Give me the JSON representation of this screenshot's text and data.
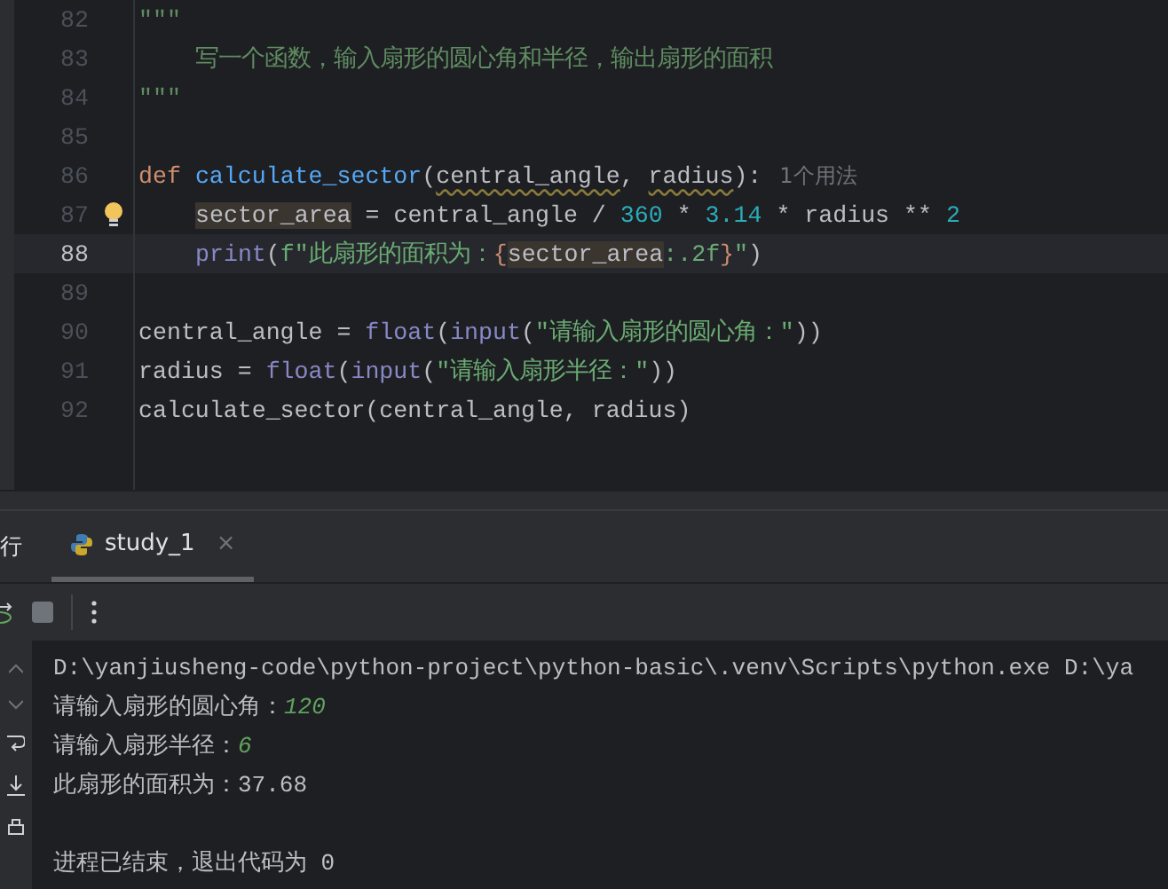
{
  "editor": {
    "lines": [
      {
        "number": "82",
        "current": false,
        "bulb": false,
        "indented": false,
        "tokens": [
          {
            "kind": "docstring",
            "text": "\"\"\""
          }
        ]
      },
      {
        "number": "83",
        "current": false,
        "bulb": false,
        "indented": true,
        "tokens": [
          {
            "kind": "docstring",
            "text": "写一个函数，输入扇形的圆心角和半径，输出扇形的面积"
          }
        ]
      },
      {
        "number": "84",
        "current": false,
        "bulb": false,
        "indented": false,
        "tokens": [
          {
            "kind": "docstring",
            "text": "\"\"\""
          }
        ]
      },
      {
        "number": "85",
        "current": false,
        "bulb": false
      },
      {
        "number": "86",
        "current": false,
        "bulb": false,
        "indented": false,
        "hint": "1个用法",
        "tokens": [
          {
            "kind": "keyword",
            "text": "def"
          },
          {
            "kind": "space"
          },
          {
            "kind": "function",
            "text": "calculate_sector"
          },
          {
            "kind": "plain",
            "text": "("
          },
          {
            "kind": "plain",
            "text": "central_angle",
            "warning": true
          },
          {
            "kind": "plain",
            "text": ","
          },
          {
            "kind": "space"
          },
          {
            "kind": "plain",
            "text": "radius",
            "warning": true
          },
          {
            "kind": "plain",
            "text": "):"
          }
        ]
      },
      {
        "number": "87",
        "current": false,
        "bulb": true,
        "indented": true,
        "tokens": [
          {
            "kind": "plain",
            "text": "sector_area",
            "highlighted": true
          },
          {
            "kind": "plain",
            "text": " = central_angle / "
          },
          {
            "kind": "number",
            "text": "360"
          },
          {
            "kind": "plain",
            "text": " * "
          },
          {
            "kind": "number",
            "text": "3.14"
          },
          {
            "kind": "plain",
            "text": " * radius ** "
          },
          {
            "kind": "number",
            "text": "2"
          }
        ]
      },
      {
        "number": "88",
        "current": true,
        "bulb": false,
        "indented": true,
        "tokens": [
          {
            "kind": "builtin",
            "text": "print"
          },
          {
            "kind": "plain",
            "text": "("
          },
          {
            "kind": "string",
            "text": "f\"此扇形的面积为："
          },
          {
            "kind": "brace",
            "text": "{"
          },
          {
            "kind": "plain",
            "text": "sector_area",
            "highlighted": true
          },
          {
            "kind": "string",
            "text": ":.2f"
          },
          {
            "kind": "brace",
            "text": "}"
          },
          {
            "kind": "string",
            "text": "\""
          },
          {
            "kind": "plain",
            "text": ")"
          }
        ]
      },
      {
        "number": "89",
        "current": false,
        "bulb": false
      },
      {
        "number": "90",
        "current": false,
        "bulb": false,
        "indented": false,
        "tokens": [
          {
            "kind": "plain",
            "text": "central_angle = "
          },
          {
            "kind": "builtin",
            "text": "float"
          },
          {
            "kind": "plain",
            "text": "("
          },
          {
            "kind": "builtin",
            "text": "input"
          },
          {
            "kind": "plain",
            "text": "("
          },
          {
            "kind": "string",
            "text": "\"请输入扇形的圆心角：\""
          },
          {
            "kind": "plain",
            "text": "))"
          }
        ]
      },
      {
        "number": "91",
        "current": false,
        "bulb": false,
        "indented": false,
        "tokens": [
          {
            "kind": "plain",
            "text": "radius = "
          },
          {
            "kind": "builtin",
            "text": "float"
          },
          {
            "kind": "plain",
            "text": "("
          },
          {
            "kind": "builtin",
            "text": "input"
          },
          {
            "kind": "plain",
            "text": "("
          },
          {
            "kind": "string",
            "text": "\"请输入扇形半径：\""
          },
          {
            "kind": "plain",
            "text": "))"
          }
        ]
      },
      {
        "number": "92",
        "current": false,
        "bulb": false,
        "indented": false,
        "tokens": [
          {
            "kind": "plain",
            "text": "calculate_sector(central_angle, radius)"
          }
        ]
      }
    ]
  },
  "run_panel": {
    "title": "行",
    "tabs": [
      {
        "label": "study_1",
        "close": "×",
        "selected": true
      }
    ],
    "console": [
      {
        "kind": "command",
        "text": "D:\\yanjiusheng-code\\python-project\\python-basic\\.venv\\Scripts\\python.exe D:\\ya"
      },
      {
        "kind": "prompt",
        "text": "请输入扇形的圆心角：",
        "input": "120"
      },
      {
        "kind": "prompt",
        "text": "请输入扇形半径：",
        "input": "6"
      },
      {
        "kind": "output",
        "text": "此扇形的面积为：37.68"
      },
      {
        "kind": "blank"
      },
      {
        "kind": "exit",
        "text": "进程已结束，退出代码为 0"
      }
    ]
  }
}
